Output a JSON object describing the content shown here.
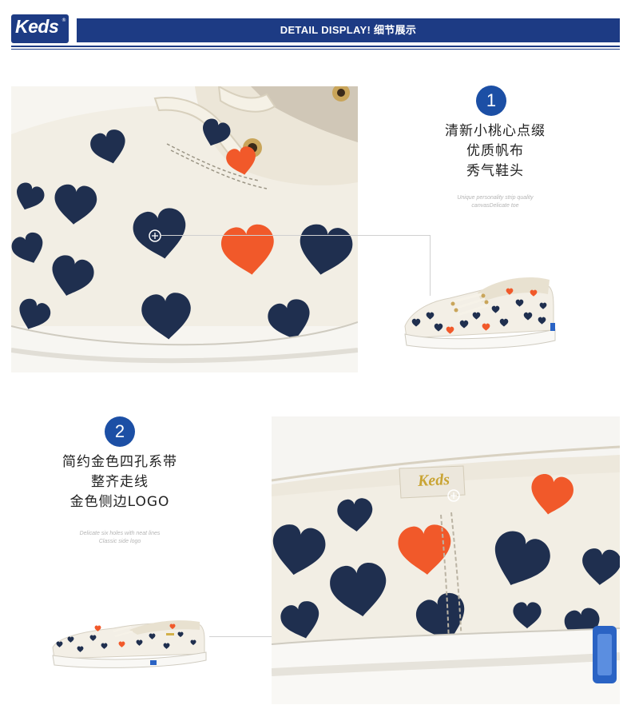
{
  "header": {
    "brand": "Keds",
    "banner_title": "DETAIL DISPLAY! 细节展示"
  },
  "feature1": {
    "number": "1",
    "lines": [
      "清新小桃心点缀",
      "优质帆布",
      "秀气鞋头"
    ],
    "subtitle": [
      "Unique personality strip quality",
      "canvasDelicate toe"
    ]
  },
  "feature2": {
    "number": "2",
    "lines": [
      "简约金色四孔系带",
      "整齐走线",
      "金色侧边LOGO"
    ],
    "subtitle": [
      "Delicate six holes with neat lines",
      "Classic side logo"
    ]
  },
  "shoe_tag_text": "Keds",
  "colors": {
    "brand_blue": "#1d3b84",
    "badge_blue": "#1c4fa5",
    "heart_navy": "#1f2f4f",
    "heart_orange": "#f1592a",
    "canvas": "#f3efe6"
  }
}
